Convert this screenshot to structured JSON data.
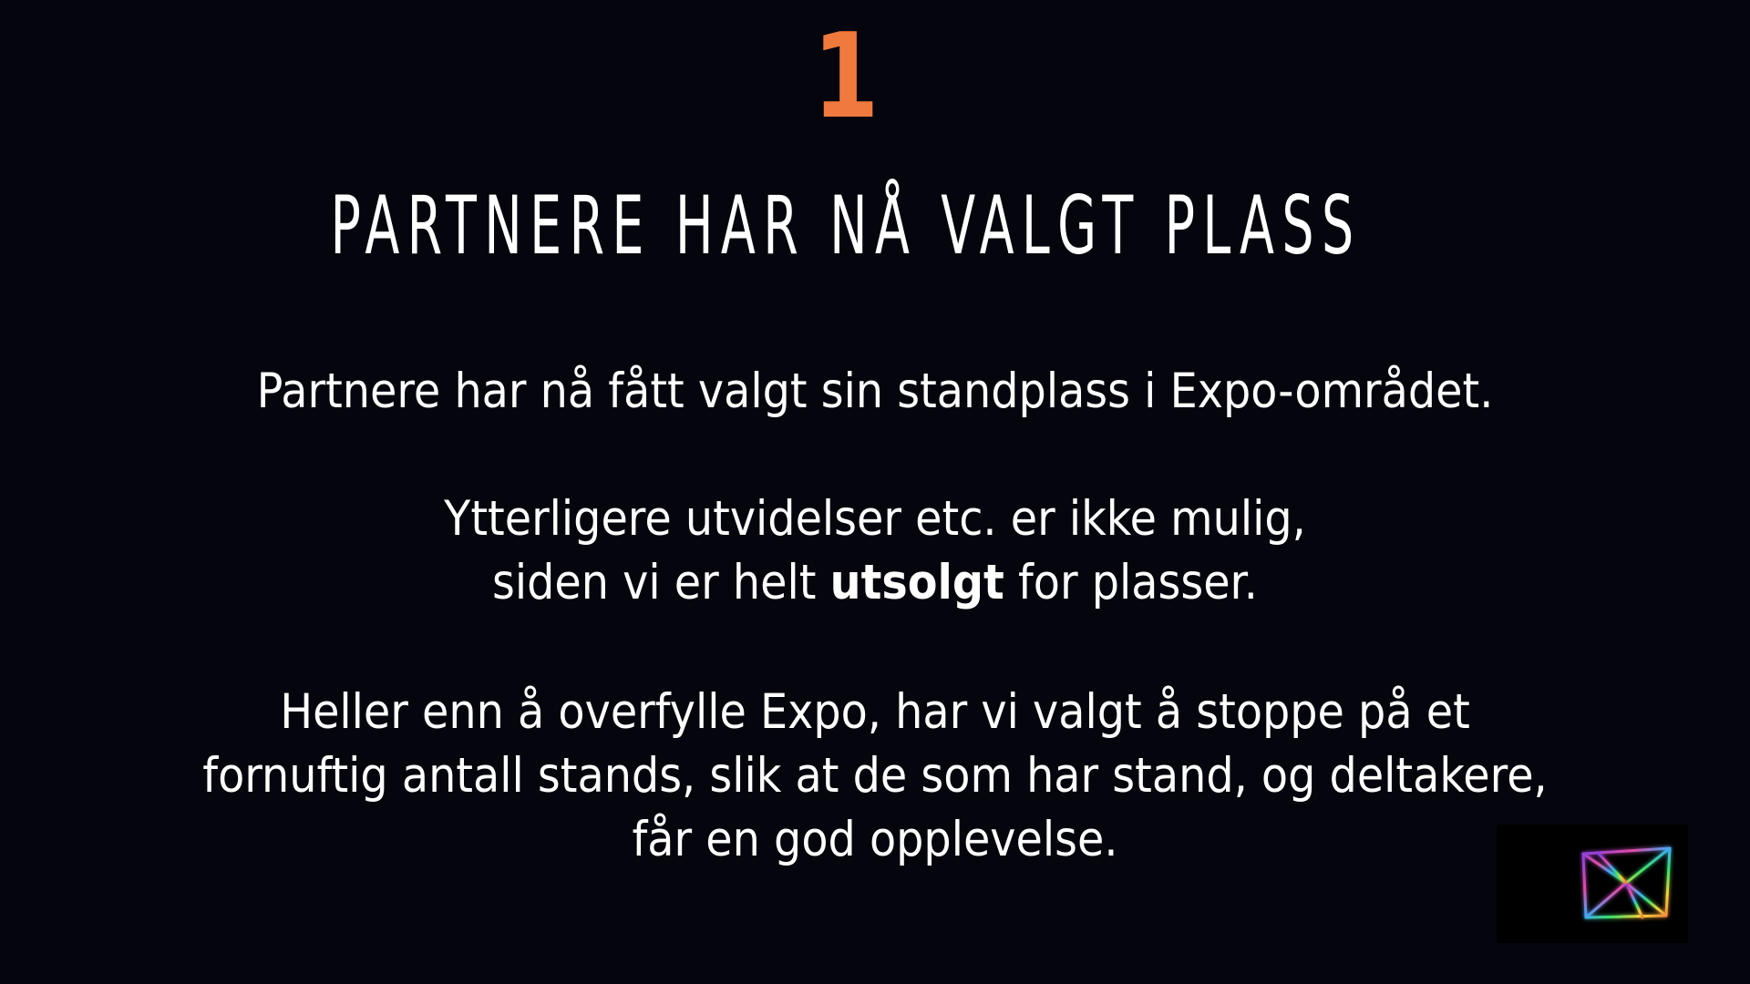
{
  "slide": {
    "number": "1",
    "title": "PARTNERE HAR NÅ VALGT PLASS",
    "paragraph1": "Partnere har nå fått valgt sin standplass i Expo-området.",
    "paragraph2": {
      "line1": "Ytterligere utvidelser etc. er ikke mulig,",
      "line2_before": "siden vi er helt ",
      "line2_bold": "utsolgt",
      "line2_after": " for plasser."
    },
    "paragraph3": {
      "line1": "Heller enn å overfylle Expo, har vi valgt å stoppe på et",
      "line2": "fornuftig antall stands, slik at de som har stand, og deltakere,",
      "line3": "får en god opplevelse."
    }
  },
  "logo": {
    "icon": "paper-plane-logo-icon",
    "gradient": [
      "#7b3fe4",
      "#e04aa8",
      "#3fa9f5",
      "#39e06a",
      "#f5d33a",
      "#f07a3e"
    ]
  },
  "colors": {
    "background": "#05050d",
    "accent": "#f07a3e",
    "text": "#ffffff"
  }
}
